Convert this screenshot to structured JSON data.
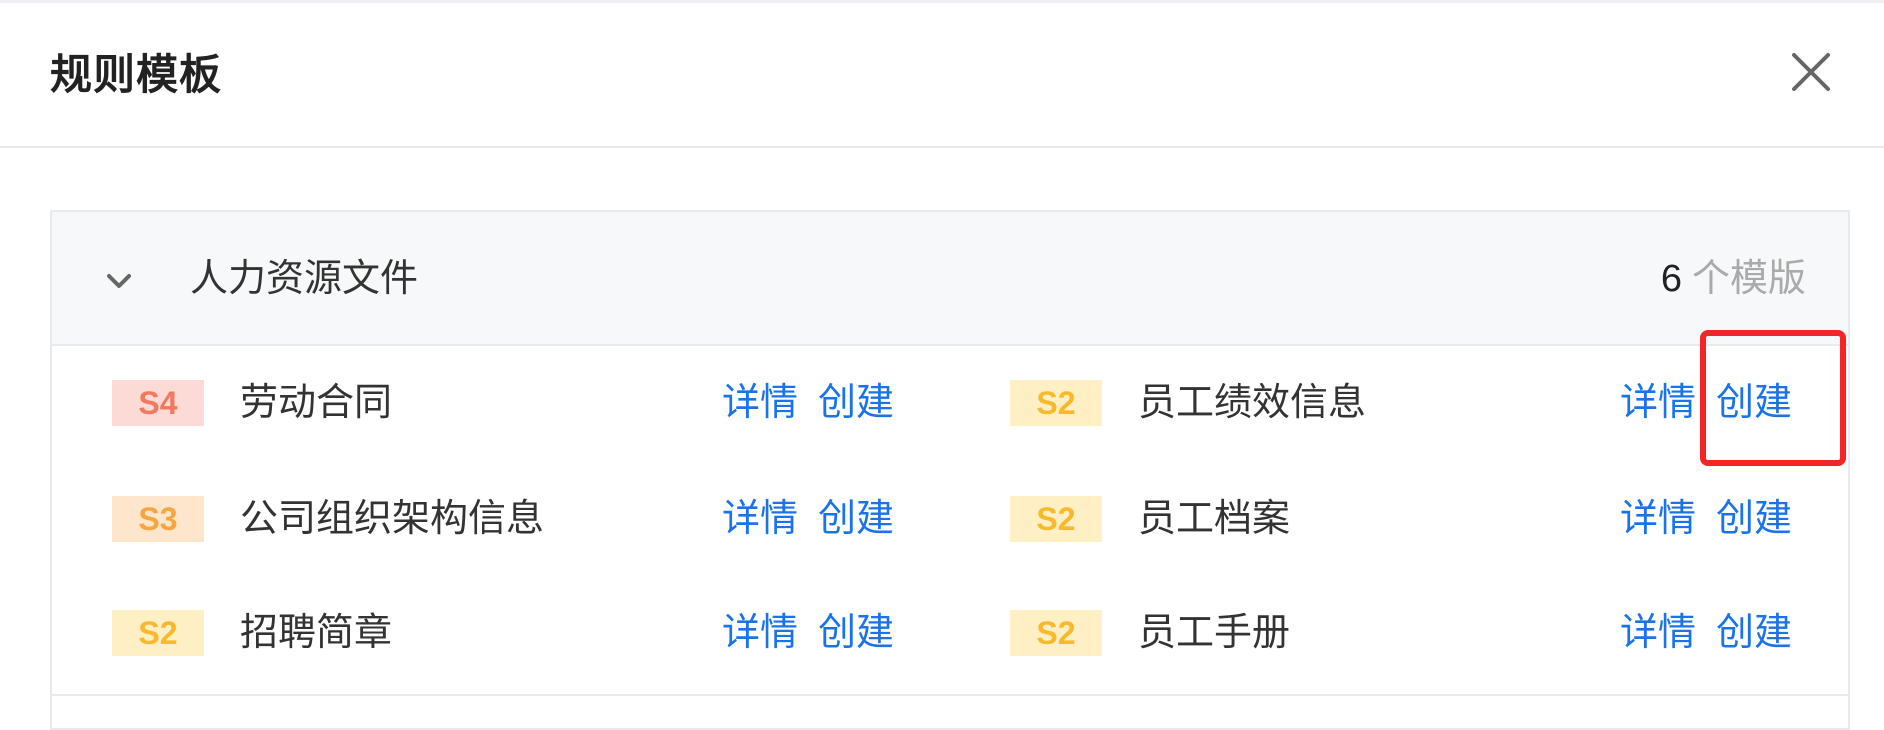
{
  "modal": {
    "title": "规则模板",
    "close_icon": "close-icon"
  },
  "group": {
    "name": "人力资源文件",
    "count": "6",
    "count_unit": "个模版",
    "chevron_icon": "chevron-down-icon"
  },
  "templates": [
    {
      "level": "S4",
      "name": "劳动合同",
      "detail": "详情",
      "create": "创建"
    },
    {
      "level": "S2",
      "name": "员工绩效信息",
      "detail": "详情",
      "create": "创建"
    },
    {
      "level": "S3",
      "name": "公司组织架构信息",
      "detail": "详情",
      "create": "创建"
    },
    {
      "level": "S2",
      "name": "员工档案",
      "detail": "详情",
      "create": "创建"
    },
    {
      "level": "S2",
      "name": "招聘简章",
      "detail": "详情",
      "create": "创建"
    },
    {
      "level": "S2",
      "name": "员工手册",
      "detail": "详情",
      "create": "创建"
    }
  ],
  "colors": {
    "link": "#1a73e8",
    "s4_bg": "#fcdad5",
    "s4_text": "#f2785f",
    "s3_bg": "#fde6cc",
    "s3_text": "#f7a53e",
    "s2_bg": "#feefc5",
    "s2_text": "#f9b92b",
    "highlight": "#f52525"
  }
}
